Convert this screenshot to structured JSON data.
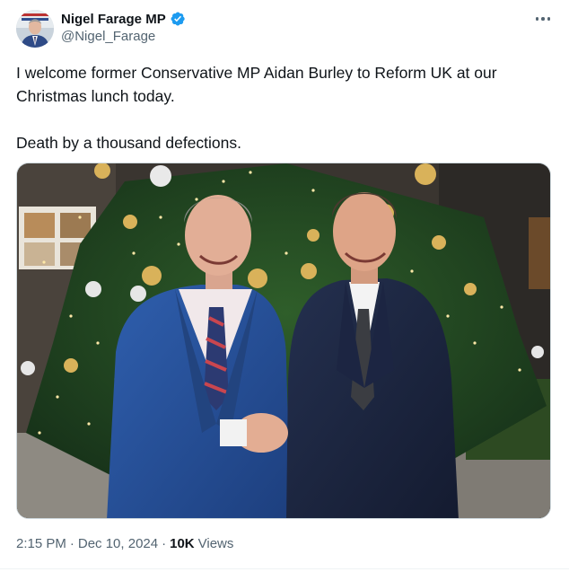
{
  "author": {
    "display_name": "Nigel Farage MP",
    "handle": "@Nigel_Farage",
    "verified_icon": "verified-badge-icon",
    "accent_color": "#1d9bf0"
  },
  "menu": {
    "icon": "more-horizontal-icon"
  },
  "tweet": {
    "paragraphs": [
      "I welcome former Conservative MP Aidan Burley to Reform UK at our Christmas lunch today.",
      "Death by a thousand defections."
    ]
  },
  "media": {
    "image_icon": "photo-two-men-shaking-hands-christmas-tree"
  },
  "meta": {
    "time": "2:15 PM",
    "separator_1": "·",
    "date": "Dec 10, 2024",
    "separator_2": "·",
    "views_count": "10K",
    "views_label": "Views"
  }
}
